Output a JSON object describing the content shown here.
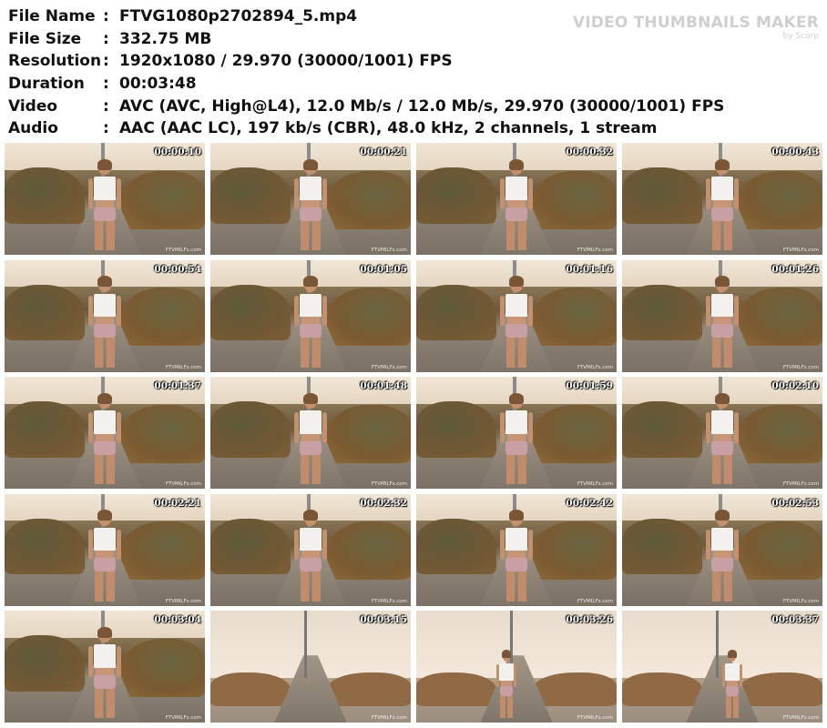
{
  "meta": [
    {
      "key": "File Name",
      "value": "FTVG1080p2702894_5.mp4"
    },
    {
      "key": "File Size",
      "value": "332.75 MB"
    },
    {
      "key": "Resolution",
      "value": "1920x1080 / 29.970 (30000/1001) FPS"
    },
    {
      "key": "Duration",
      "value": "00:03:48"
    },
    {
      "key": "Video",
      "value": "AVC (AVC, High@L4), 12.0 Mb/s / 12.0 Mb/s, 29.970 (30000/1001) FPS"
    },
    {
      "key": "Audio",
      "value": "AAC (AAC LC), 197 kb/s (CBR), 48.0 kHz, 2 channels, 1 stream"
    }
  ],
  "separator": ":",
  "brand": {
    "title": "VIDEO THUMBNAILS MAKER",
    "sub": "by Scorp"
  },
  "watermark": "FTVMILFs.com",
  "thumbnails": [
    {
      "time": "00:00:10",
      "scene": "day"
    },
    {
      "time": "00:00:21",
      "scene": "day"
    },
    {
      "time": "00:00:32",
      "scene": "day"
    },
    {
      "time": "00:00:43",
      "scene": "day"
    },
    {
      "time": "00:00:54",
      "scene": "day"
    },
    {
      "time": "00:01:05",
      "scene": "day"
    },
    {
      "time": "00:01:16",
      "scene": "day"
    },
    {
      "time": "00:01:26",
      "scene": "day"
    },
    {
      "time": "00:01:37",
      "scene": "day"
    },
    {
      "time": "00:01:48",
      "scene": "day"
    },
    {
      "time": "00:01:59",
      "scene": "day"
    },
    {
      "time": "00:02:10",
      "scene": "day"
    },
    {
      "time": "00:02:21",
      "scene": "day"
    },
    {
      "time": "00:02:32",
      "scene": "day"
    },
    {
      "time": "00:02:42",
      "scene": "day"
    },
    {
      "time": "00:02:53",
      "scene": "day"
    },
    {
      "time": "00:03:04",
      "scene": "day"
    },
    {
      "time": "00:03:15",
      "scene": "dusk"
    },
    {
      "time": "00:03:26",
      "scene": "dusk"
    },
    {
      "time": "00:03:37",
      "scene": "dusk"
    }
  ]
}
